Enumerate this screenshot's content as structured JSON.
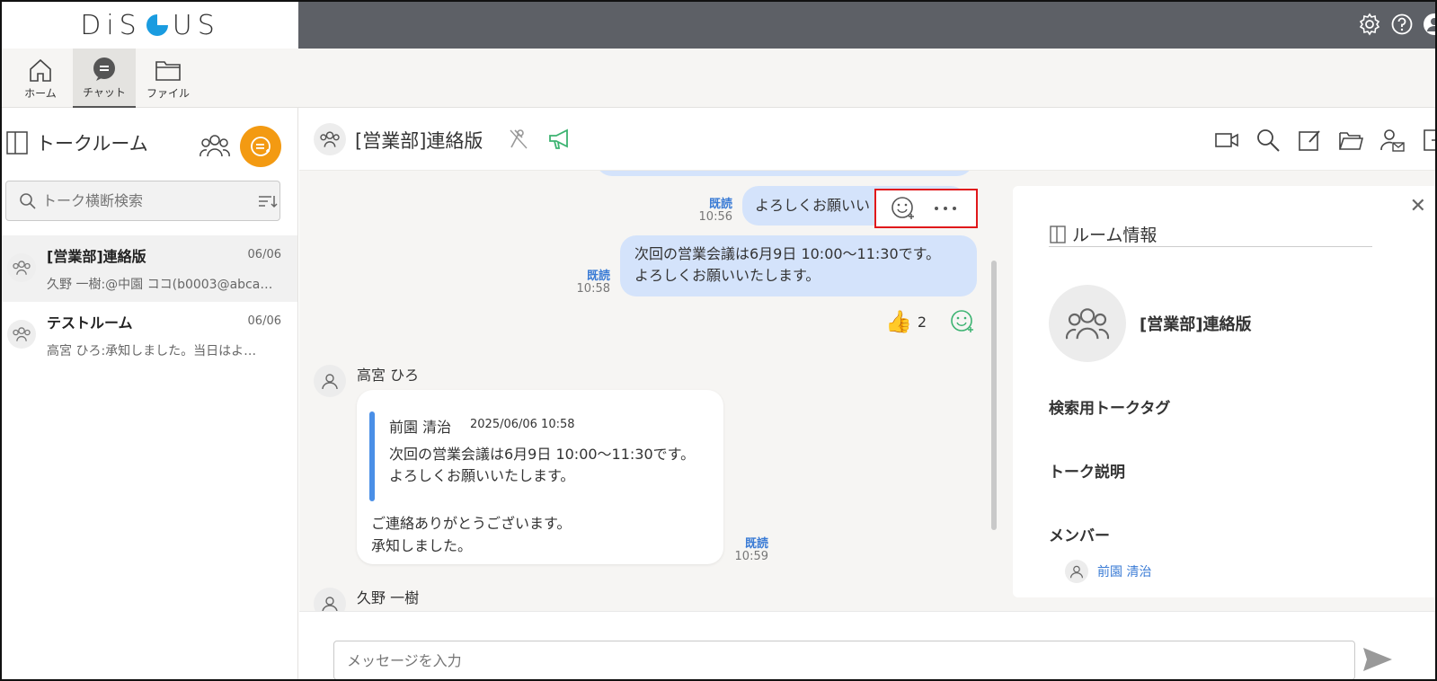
{
  "app": {
    "logo_text_left": "DiS",
    "logo_text_right": "US",
    "brand_colors": {
      "logo_blue": "#1a9ce0",
      "accent_orange": "#f39a12",
      "topbar": "#5d6066",
      "read_blue": "#3a7bd5",
      "highlight_red": "#e0181b"
    }
  },
  "nav": {
    "items": [
      {
        "label": "ホーム",
        "icon": "home-icon"
      },
      {
        "label": "チャット",
        "icon": "chat-icon",
        "active": true
      },
      {
        "label": "ファイル",
        "icon": "folder-icon"
      }
    ]
  },
  "sidebar": {
    "title": "トークルーム",
    "search_placeholder": "トーク横断検索",
    "rooms": [
      {
        "name": "[営業部]連絡版",
        "date": "06/06",
        "preview": "久野 一樹:@中園 ココ(b0003@abca…",
        "selected": true
      },
      {
        "name": "テストルーム",
        "date": "06/06",
        "preview": "高宮 ひろ:承知しました。当日はよ…"
      }
    ]
  },
  "chat": {
    "title": "[営業部]連絡版",
    "messages": {
      "m1": {
        "text": "よろしくお願いい",
        "read": "既読",
        "time": "10:56"
      },
      "m2": {
        "line1": "次回の営業会議は6月9日 10:00〜11:30です。",
        "line2": "よろしくお願いいたします。",
        "read": "既読",
        "time": "10:58"
      },
      "reaction": {
        "emoji": "👍",
        "count": "2"
      },
      "m3": {
        "sender": "高宮 ひろ",
        "quote_author": "前園 清治",
        "quote_date": "2025/06/06 10:58",
        "quote_line1": "次回の営業会議は6月9日 10:00〜11:30です。",
        "quote_line2": "よろしくお願いいたします。",
        "line1": "ご連絡ありがとうございます。",
        "line2": "承知しました。",
        "read": "既読",
        "time": "10:59"
      },
      "m4": {
        "sender": "久野 一樹"
      }
    },
    "input_placeholder": "メッセージを入力"
  },
  "room_info": {
    "title": "ルーム情報",
    "room_name": "[営業部]連絡版",
    "tag_label": "検索用トークタグ",
    "desc_label": "トーク説明",
    "members_label": "メンバー",
    "members": [
      {
        "name": "前園 清治"
      }
    ]
  }
}
